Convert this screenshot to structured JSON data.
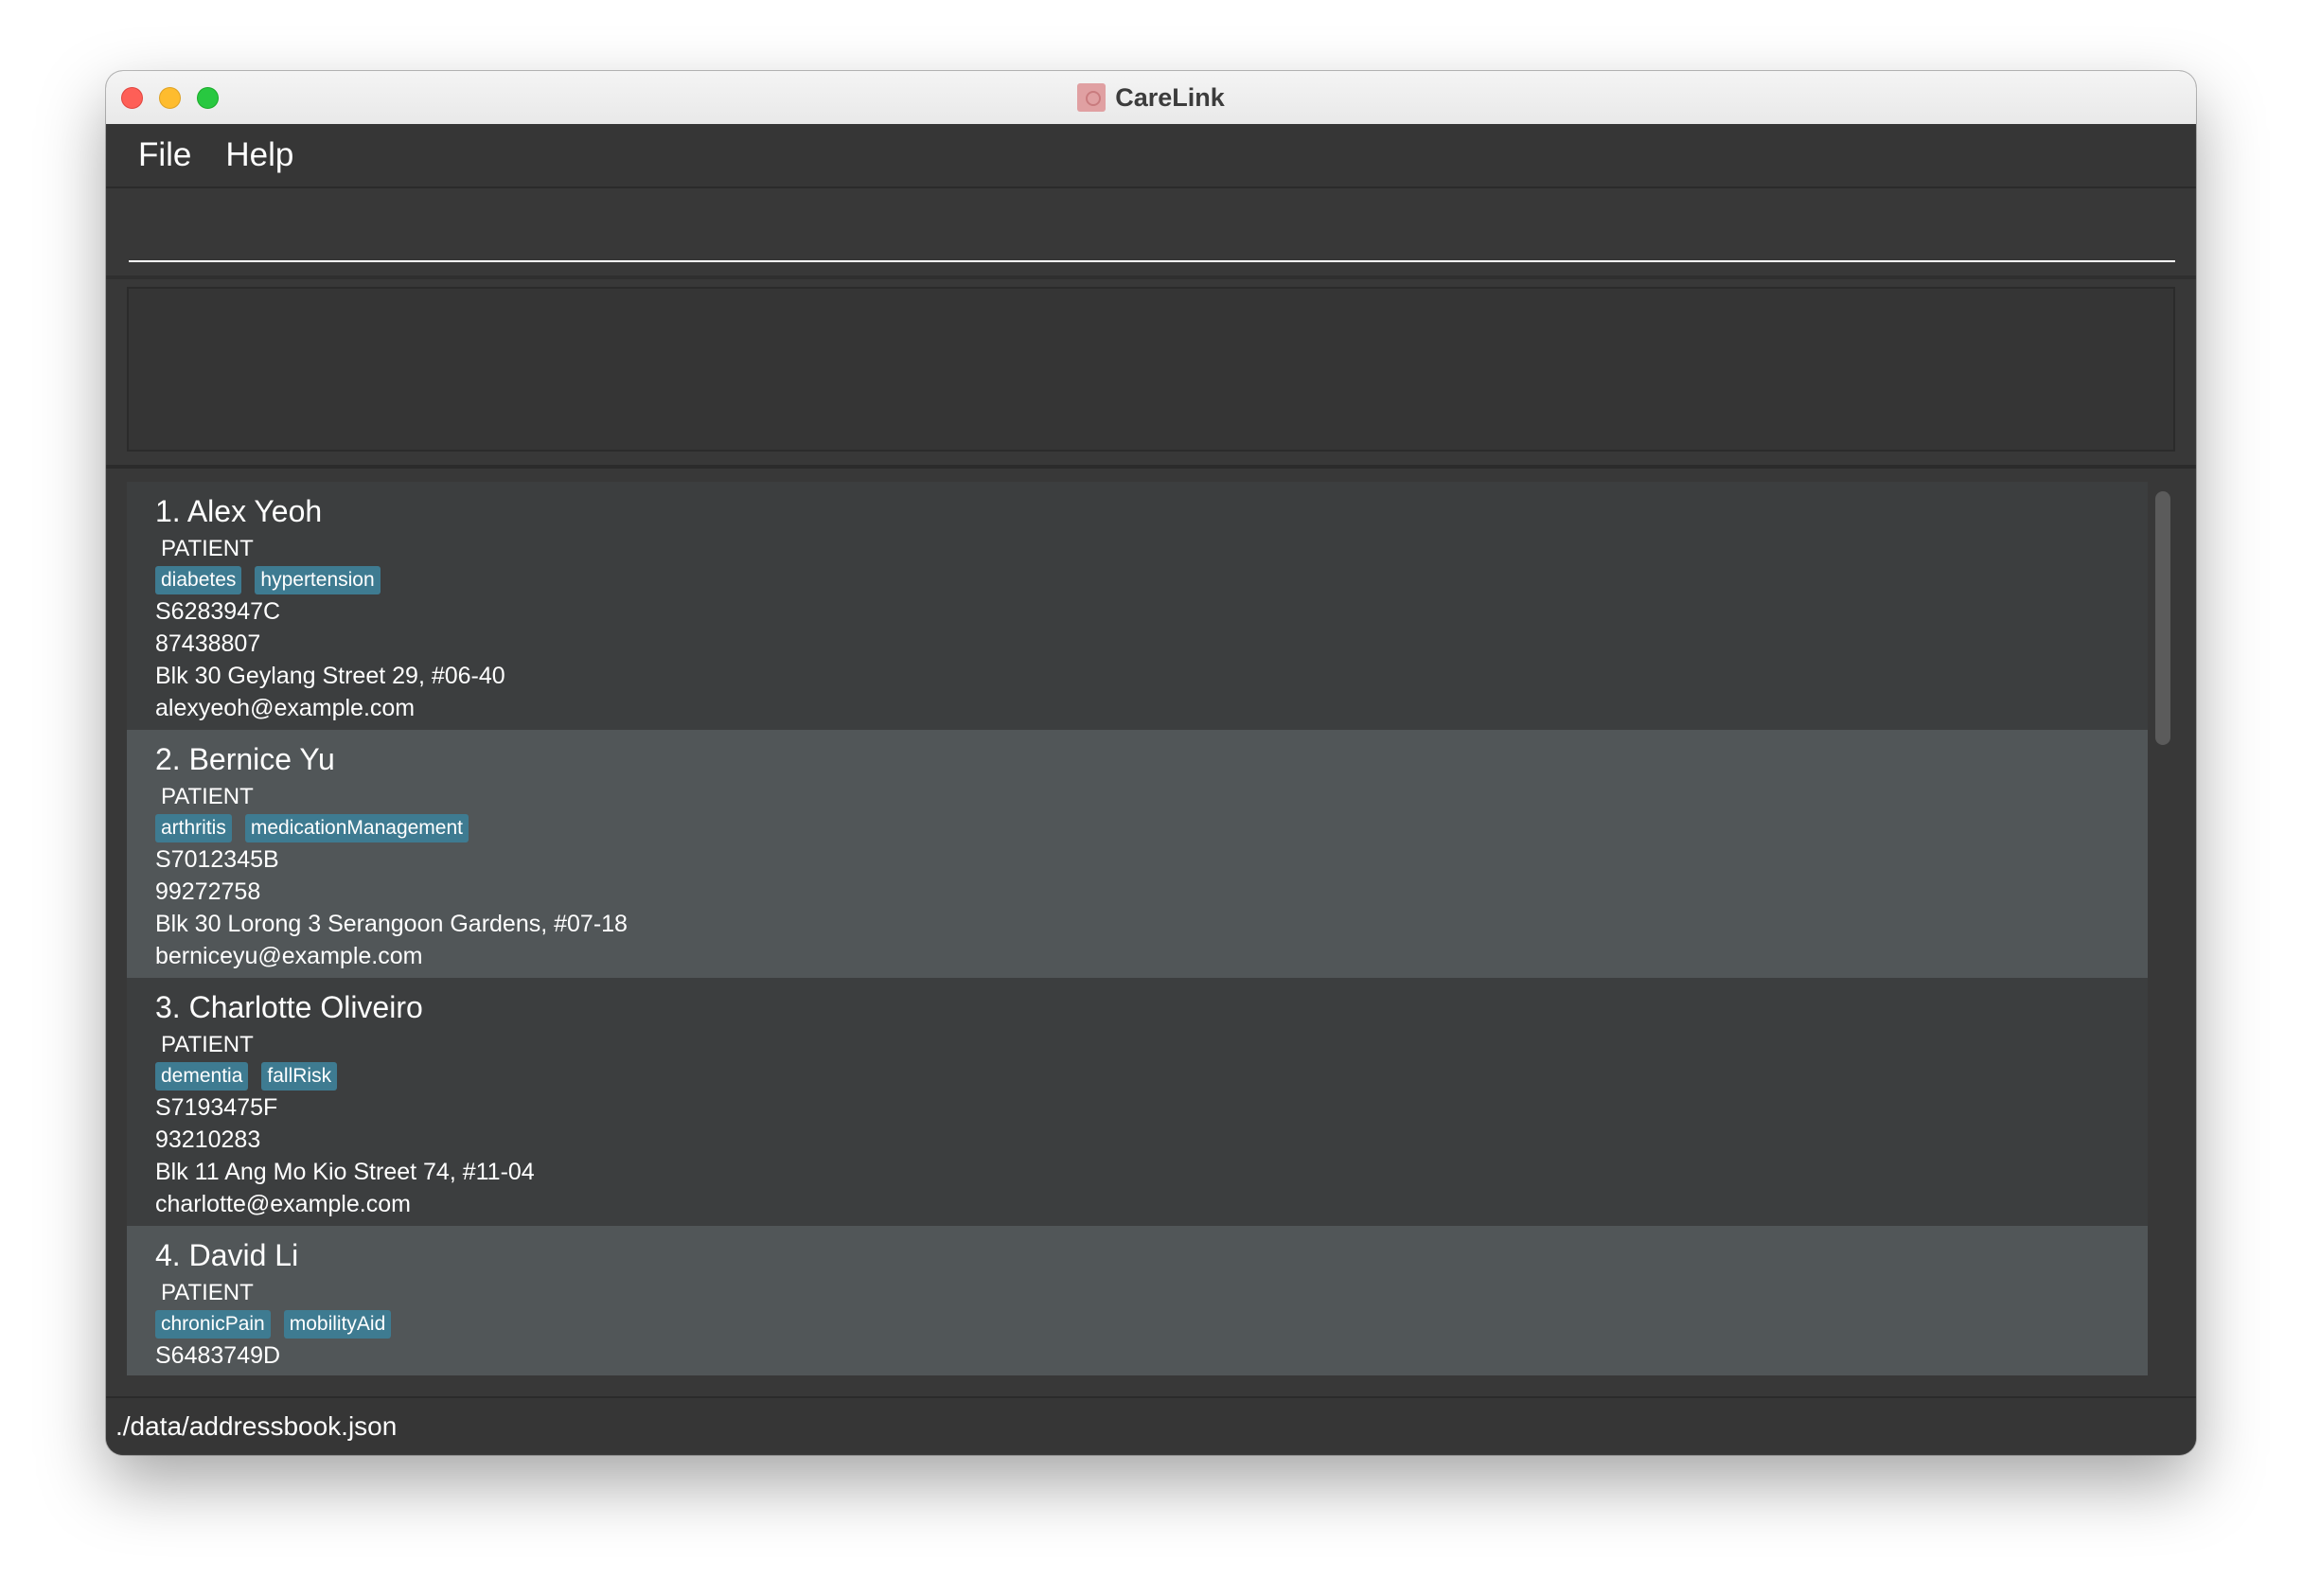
{
  "window": {
    "title": "CareLink",
    "icon": "carelink-app-icon"
  },
  "menu": {
    "file_label": "File",
    "help_label": "Help"
  },
  "command": {
    "value": "",
    "placeholder": ""
  },
  "result": {
    "text": ""
  },
  "persons": [
    {
      "name": "1. Alex Yeoh",
      "role": "PATIENT",
      "tags": [
        "diabetes",
        "hypertension"
      ],
      "nric": "S6283947C",
      "phone": "87438807",
      "address": "Blk 30 Geylang Street 29, #06-40",
      "email": "alexyeoh@example.com"
    },
    {
      "name": "2. Bernice Yu",
      "role": "PATIENT",
      "tags": [
        "arthritis",
        "medicationManagement"
      ],
      "nric": "S7012345B",
      "phone": "99272758",
      "address": "Blk 30 Lorong 3 Serangoon Gardens, #07-18",
      "email": "berniceyu@example.com"
    },
    {
      "name": "3. Charlotte Oliveiro",
      "role": "PATIENT",
      "tags": [
        "dementia",
        "fallRisk"
      ],
      "nric": "S7193475F",
      "phone": "93210283",
      "address": "Blk 11 Ang Mo Kio Street 74, #11-04",
      "email": "charlotte@example.com"
    },
    {
      "name": "4. David Li",
      "role": "PATIENT",
      "tags": [
        "chronicPain",
        "mobilityAid"
      ],
      "nric": "S6483749D",
      "phone": "",
      "address": "",
      "email": ""
    }
  ],
  "status": {
    "file_path": "./data/addressbook.json"
  },
  "colors": {
    "tag_background": "#3e7b91",
    "card_odd": "#3c3e3f",
    "card_even": "#515658",
    "window_background": "#3a3a3c"
  }
}
